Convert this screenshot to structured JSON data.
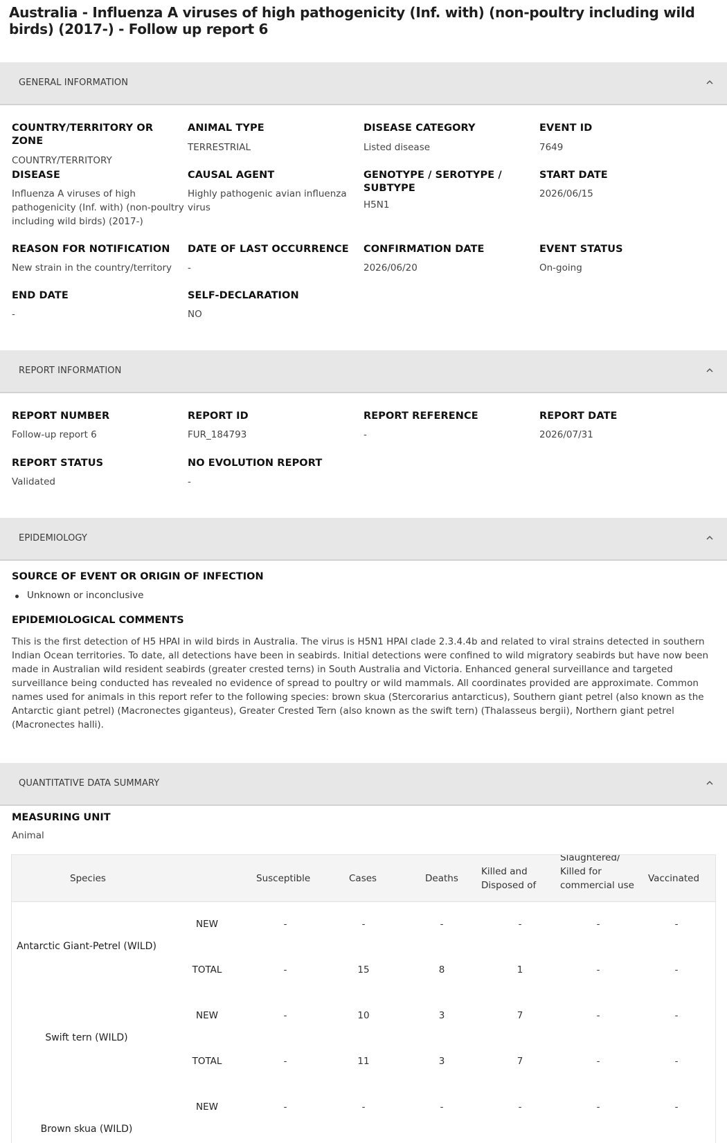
{
  "title": "Australia - Influenza A viruses of high pathogenicity (Inf. with) (non-poultry including wild birds) (2017-) - Follow up report 6",
  "sections": {
    "general": "GENERAL INFORMATION",
    "report": "REPORT INFORMATION",
    "epidemiology": "EPIDEMIOLOGY",
    "quantitative": "QUANTITATIVE DATA SUMMARY"
  },
  "general": {
    "country_label": "COUNTRY/TERRITORY OR ZONE",
    "country_value": "COUNTRY/TERRITORY",
    "animal_type_label": "ANIMAL TYPE",
    "animal_type_value": "TERRESTRIAL",
    "disease_category_label": "DISEASE CATEGORY",
    "disease_category_value": "Listed disease",
    "event_id_label": "EVENT ID",
    "event_id_value": "7649",
    "disease_label": "DISEASE",
    "disease_value": "Influenza A viruses of high pathogenicity (Inf. with) (non-poultry including wild birds) (2017-)",
    "causal_agent_label": "CAUSAL AGENT",
    "causal_agent_value": "Highly pathogenic avian influenza virus",
    "genotype_label": "GENOTYPE / SEROTYPE / SUBTYPE",
    "genotype_value": "H5N1",
    "start_date_label": "START DATE",
    "start_date_value": "2026/06/15",
    "reason_label": "REASON FOR NOTIFICATION",
    "reason_value": "New strain in the country/territory",
    "last_occurrence_label": "DATE OF LAST OCCURRENCE",
    "last_occurrence_value": "-",
    "confirmation_label": "CONFIRMATION DATE",
    "confirmation_value": "2026/06/20",
    "event_status_label": "EVENT STATUS",
    "event_status_value": "On-going",
    "end_date_label": "END DATE",
    "end_date_value": "-",
    "self_declaration_label": "SELF-DECLARATION",
    "self_declaration_value": "NO"
  },
  "report": {
    "number_label": "REPORT NUMBER",
    "number_value": "Follow-up report 6",
    "id_label": "REPORT ID",
    "id_value": "FUR_184793",
    "reference_label": "REPORT REFERENCE",
    "reference_value": "-",
    "date_label": "REPORT DATE",
    "date_value": "2026/07/31",
    "status_label": "REPORT STATUS",
    "status_value": "Validated",
    "no_evolution_label": "NO EVOLUTION REPORT",
    "no_evolution_value": "-"
  },
  "epidemiology": {
    "source_label": "SOURCE OF EVENT OR ORIGIN OF INFECTION",
    "source_items": [
      "Unknown or inconclusive"
    ],
    "comments_label": "EPIDEMIOLOGICAL COMMENTS",
    "comments": "This is the first detection of H5 HPAI in wild birds in Australia. The virus is H5N1 HPAI clade 2.3.4.4b and related to viral strains detected in southern Indian Ocean territories. To date, all detections have been in seabirds. Initial detections were confined to wild migratory seabirds but have now been made in Australian wild resident seabirds (greater crested terns) in South Australia and Victoria. Enhanced general surveillance and targeted surveillance being conducted has revealed no evidence of spread to poultry or wild mammals. All coordinates provided are approximate. Common names used for animals in this report refer to the following species: brown skua (Stercorarius antarcticus), Southern giant petrel (also known as the Antarctic giant petrel) (Macronectes giganteus), Greater Crested Tern (also known as the swift tern) (Thalasseus bergii), Northern giant petrel (Macronectes halli)."
  },
  "quantitative": {
    "unit_label": "MEASURING UNIT",
    "unit_value": "Animal",
    "headers": {
      "species": "Species",
      "susceptible": "Susceptible",
      "cases": "Cases",
      "deaths": "Deaths",
      "killed": "Killed and Disposed of",
      "slaughtered": "Slaughtered/ Killed for commercial use",
      "vaccinated": "Vaccinated"
    },
    "rows": [
      {
        "species": "Antarctic Giant-Petrel (WILD)",
        "new": {
          "type": "NEW",
          "susceptible": "-",
          "cases": "-",
          "deaths": "-",
          "killed": "-",
          "slaughtered": "-",
          "vaccinated": "-"
        },
        "total": {
          "type": "TOTAL",
          "susceptible": "-",
          "cases": "15",
          "deaths": "8",
          "killed": "1",
          "slaughtered": "-",
          "vaccinated": "-"
        }
      },
      {
        "species": "Swift tern (WILD)",
        "new": {
          "type": "NEW",
          "susceptible": "-",
          "cases": "10",
          "deaths": "3",
          "killed": "7",
          "slaughtered": "-",
          "vaccinated": "-"
        },
        "total": {
          "type": "TOTAL",
          "susceptible": "-",
          "cases": "11",
          "deaths": "3",
          "killed": "7",
          "slaughtered": "-",
          "vaccinated": "-"
        }
      },
      {
        "species": "Brown skua (WILD)",
        "new": {
          "type": "NEW",
          "susceptible": "-",
          "cases": "-",
          "deaths": "-",
          "killed": "-",
          "slaughtered": "-",
          "vaccinated": "-"
        }
      }
    ]
  },
  "colors": {
    "section_bg": "#e7e7e7",
    "table_header_bg": "#f4f4f4",
    "text": "#222222"
  },
  "icons": {
    "section_toggle": "chevron-up-icon"
  }
}
